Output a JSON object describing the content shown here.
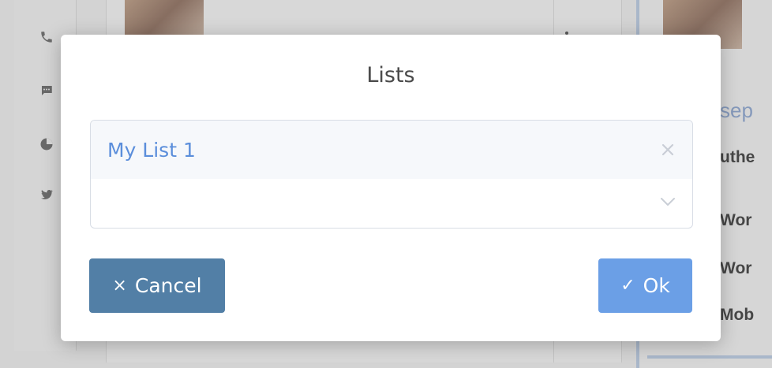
{
  "dialog": {
    "title": "Lists",
    "selected_list": "My List 1",
    "clear_icon": "close-icon",
    "dropdown_icon": "chevron-down-icon",
    "cancel_label": "Cancel",
    "cancel_icon": "×",
    "ok_label": "Ok",
    "ok_icon": "✓"
  },
  "background": {
    "sidebar_icons": [
      "phone-icon",
      "chat-icon",
      "pie-chart-icon",
      "twitter-icon"
    ],
    "right_panel_text": [
      "sep",
      "uthe",
      "Wor",
      "Wor",
      "Mob"
    ]
  },
  "colors": {
    "accent_blue": "#5b8edb",
    "cancel_button": "#527fa6",
    "ok_button": "#6b9fe6"
  }
}
